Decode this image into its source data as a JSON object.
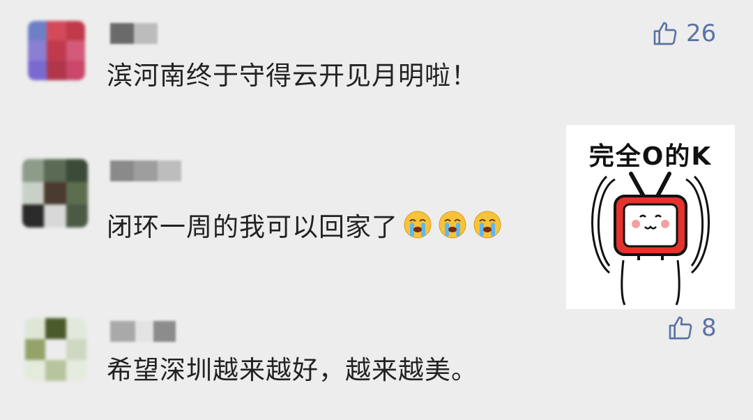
{
  "comments": [
    {
      "text": "滨河南终于守得云开见月明啦！",
      "likes": "26",
      "avatar_colors": [
        "#6f7fc7",
        "#d44a5a",
        "#c03a4a",
        "#8a7fd2",
        "#bf3a4c",
        "#d35a7a",
        "#7a6ad0",
        "#b0374a",
        "#c9486a"
      ],
      "name_colors": [
        "#6a6a6a",
        "#bcbcbc"
      ]
    },
    {
      "text": "闭环一周的我可以回家了",
      "emoji_count": 3,
      "emoji": "crying-face",
      "avatar_colors": [
        "#8c9b8a",
        "#5a6a55",
        "#3c4a38",
        "#c9d0c8",
        "#4a3a30",
        "#5d6e50",
        "#2a2a2a",
        "#d8d8d8",
        "#4a5a45"
      ],
      "name_colors": [
        "#8a8a8a",
        "#9e9e9e",
        "#bdbdbd"
      ]
    },
    {
      "text": "希望深圳越来越好，越来越美。",
      "likes": "8",
      "avatar_colors": [
        "#dfe6d6",
        "#4a5a2a",
        "#e2e8dc",
        "#93a36a",
        "#ececec",
        "#cfd8c2",
        "#e4eadc",
        "#b8c49e",
        "#e6ebe0"
      ],
      "name_colors": [
        "#a9a9a9",
        "#e3e3e3",
        "#8c8c8c"
      ]
    }
  ],
  "sticker": {
    "caption": "完全O的K",
    "icon": "tv-mascot-thumbs-up"
  },
  "colors": {
    "background": "#ededed",
    "like_blue": "#5b72a6",
    "text": "#222222"
  }
}
